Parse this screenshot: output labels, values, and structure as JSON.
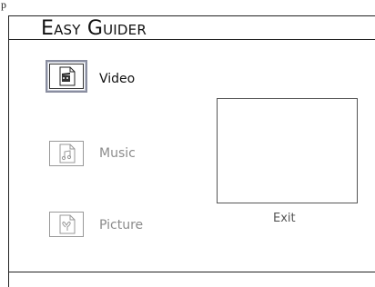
{
  "app": {
    "title": "Easy Guider",
    "top_fragment": "p"
  },
  "menu": {
    "items": [
      {
        "label": "Video",
        "icon": "video-file-icon",
        "selected": true
      },
      {
        "label": "Music",
        "icon": "music-file-icon",
        "selected": false
      },
      {
        "label": "Picture",
        "icon": "picture-file-icon",
        "selected": false
      }
    ]
  },
  "exit_label": "Exit",
  "colors": {
    "selection_border": "#8a8ea0",
    "inactive_text": "#8c8c8c",
    "line": "#222222"
  }
}
